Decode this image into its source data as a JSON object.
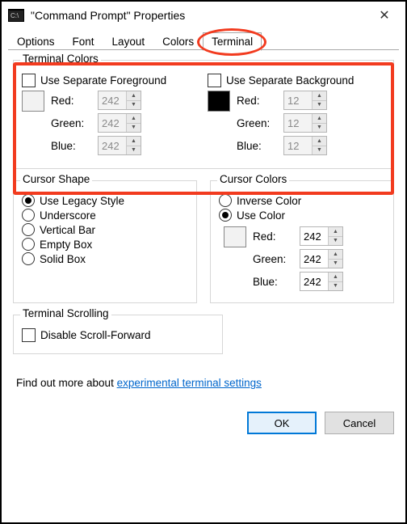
{
  "window": {
    "title": "\"Command Prompt\" Properties"
  },
  "tabs": [
    "Options",
    "Font",
    "Layout",
    "Colors",
    "Terminal"
  ],
  "active_tab": 4,
  "terminal_colors": {
    "title": "Terminal Colors",
    "fg": {
      "checkbox_label": "Use Separate Foreground",
      "checked": false,
      "swatch": "#f2f2f2",
      "red_label": "Red:",
      "red": "242",
      "green_label": "Green:",
      "green": "242",
      "blue_label": "Blue:",
      "blue": "242",
      "enabled": false
    },
    "bg": {
      "checkbox_label": "Use Separate Background",
      "checked": false,
      "swatch": "#000000",
      "red_label": "Red:",
      "red": "12",
      "green_label": "Green:",
      "green": "12",
      "blue_label": "Blue:",
      "blue": "12",
      "enabled": false
    }
  },
  "cursor_shape": {
    "title": "Cursor Shape",
    "options": [
      "Use Legacy Style",
      "Underscore",
      "Vertical Bar",
      "Empty Box",
      "Solid Box"
    ],
    "selected": 0
  },
  "cursor_colors": {
    "title": "Cursor Colors",
    "inverse_label": "Inverse Color",
    "use_color_label": "Use Color",
    "selected": "use_color",
    "swatch": "#f2f2f2",
    "red_label": "Red:",
    "red": "242",
    "green_label": "Green:",
    "green": "242",
    "blue_label": "Blue:",
    "blue": "242"
  },
  "terminal_scrolling": {
    "title": "Terminal Scrolling",
    "disable_label": "Disable Scroll-Forward",
    "checked": false
  },
  "info": {
    "prefix": "Find out more about ",
    "link": "experimental terminal settings"
  },
  "buttons": {
    "ok": "OK",
    "cancel": "Cancel"
  }
}
